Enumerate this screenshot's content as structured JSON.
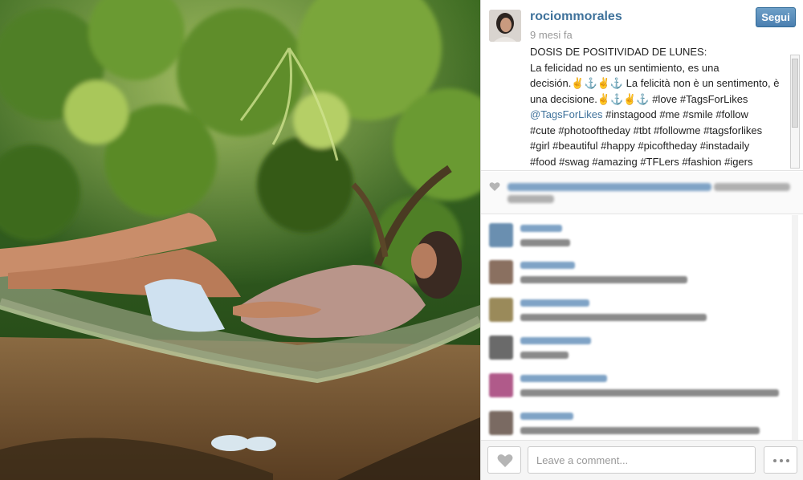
{
  "post": {
    "username": "rociommorales",
    "time_ago": "9 mesi fa",
    "follow_label": "Segui"
  },
  "caption": {
    "line1": "DOSIS DE POSITIVIDAD DE LUNES:",
    "line2": "La felicidad no es un sentimiento, es una",
    "line3": "decisión.✌⚓✌⚓ La felicità non è un sentimento, è",
    "line4": "una decisione.✌⚓✌⚓ #love #TagsForLikes",
    "mention": "@TagsForLikes",
    "line5_rest": " #instagood #me #smile #follow",
    "line6": "#cute #photooftheday #tbt #followme #tagsforlikes",
    "line7": "#girl #beautiful #happy #picoftheday #instadaily",
    "line8": "#food #swag #amazing #TFLers #fashion #igers"
  },
  "footer": {
    "comment_placeholder": "Leave a comment..."
  },
  "icons": {
    "like": "heart-icon",
    "more": "ellipsis-icon",
    "likes_heart": "heart-icon"
  },
  "colors": {
    "username": "#3f729b",
    "follow_button": "#4b7fb0",
    "text": "#222222",
    "muted": "#999999"
  }
}
